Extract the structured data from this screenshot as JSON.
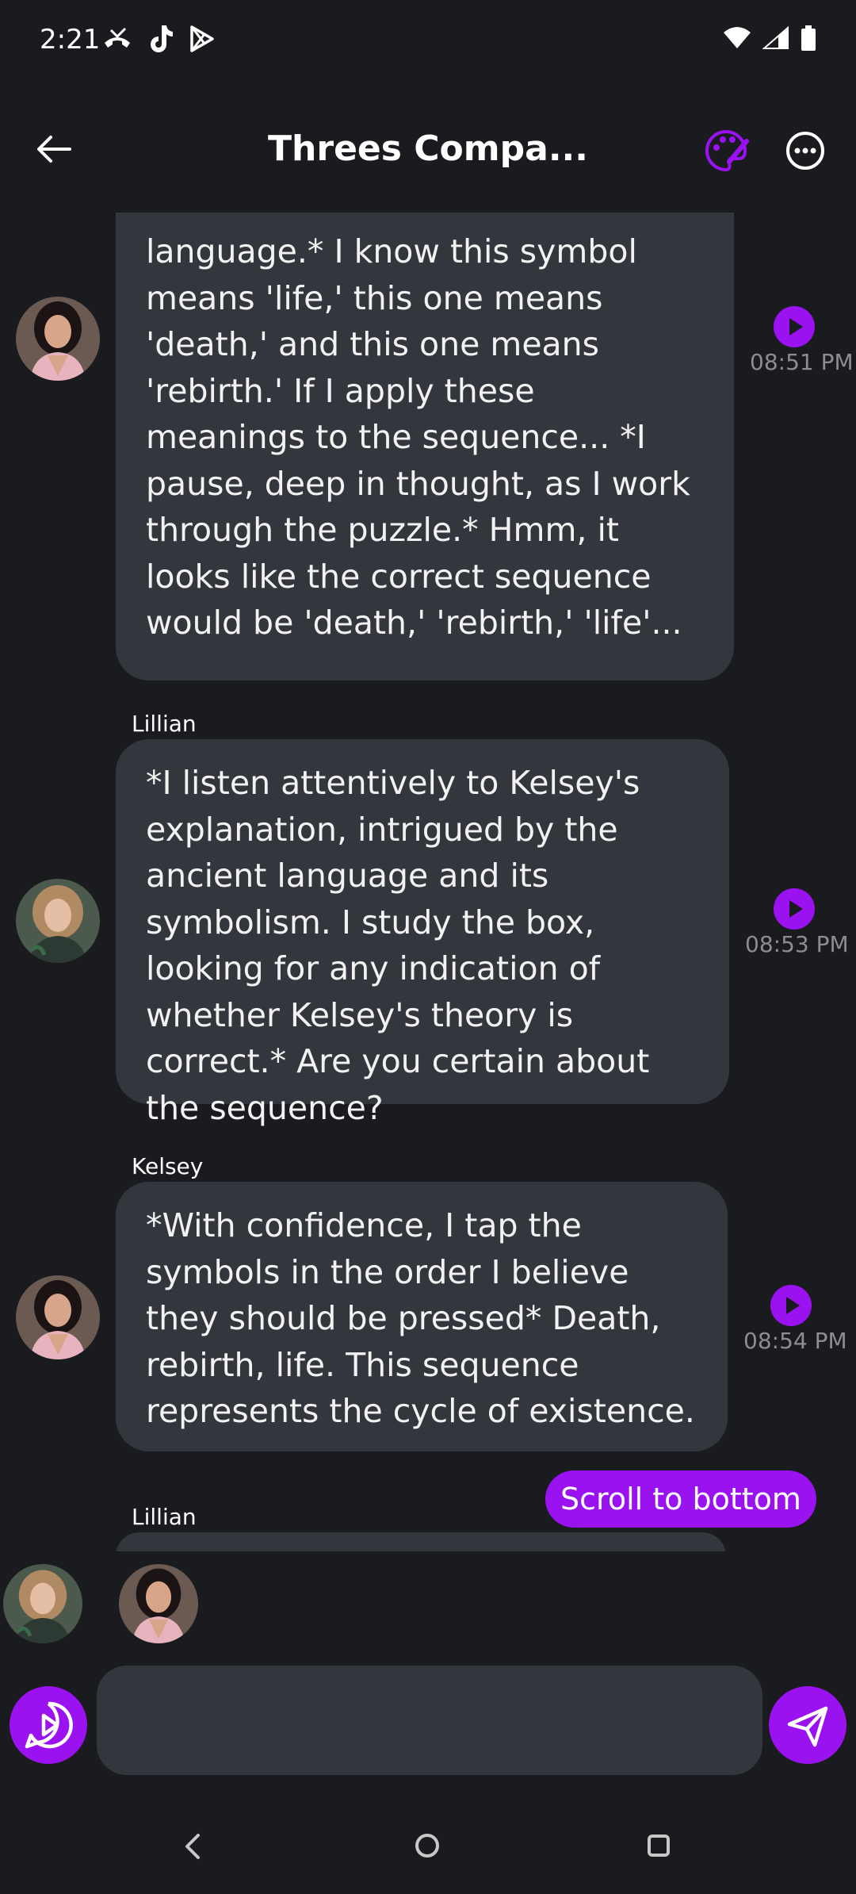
{
  "status_bar": {
    "time": "2:21"
  },
  "header": {
    "title": "Threes Compa..."
  },
  "messages": [
    {
      "sender": "",
      "text": "language.* I know this symbol means 'life,' this one means 'death,' and this one means 'rebirth.' If I apply these meanings to the sequence... *I pause, deep in thought, as I work through the puzzle.* Hmm, it looks like the correct sequence would be 'death,' 'rebirth,' 'life'...",
      "time": "08:51 PM"
    },
    {
      "sender": "Lillian",
      "text": "*I listen attentively to Kelsey's explanation, intrigued by the ancient language and its symbolism. I study the box, looking for any indication of whether Kelsey's theory is correct.* Are you certain about the sequence?",
      "time": "08:53 PM"
    },
    {
      "sender": "Kelsey",
      "text": "*With confidence, I tap the symbols in the order I believe they should be pressed* Death, rebirth, life. This sequence represents the cycle of existence.",
      "time": "08:54 PM"
    },
    {
      "sender": "Lillian",
      "text": "",
      "time": ""
    }
  ],
  "scroll_button": {
    "label": "Scroll to bottom"
  },
  "composer": {
    "placeholder": ""
  },
  "colors": {
    "accent": "#9b12f0",
    "background": "#1a1b1f",
    "bubble": "#34363d",
    "timestamp": "#8b8d93"
  }
}
